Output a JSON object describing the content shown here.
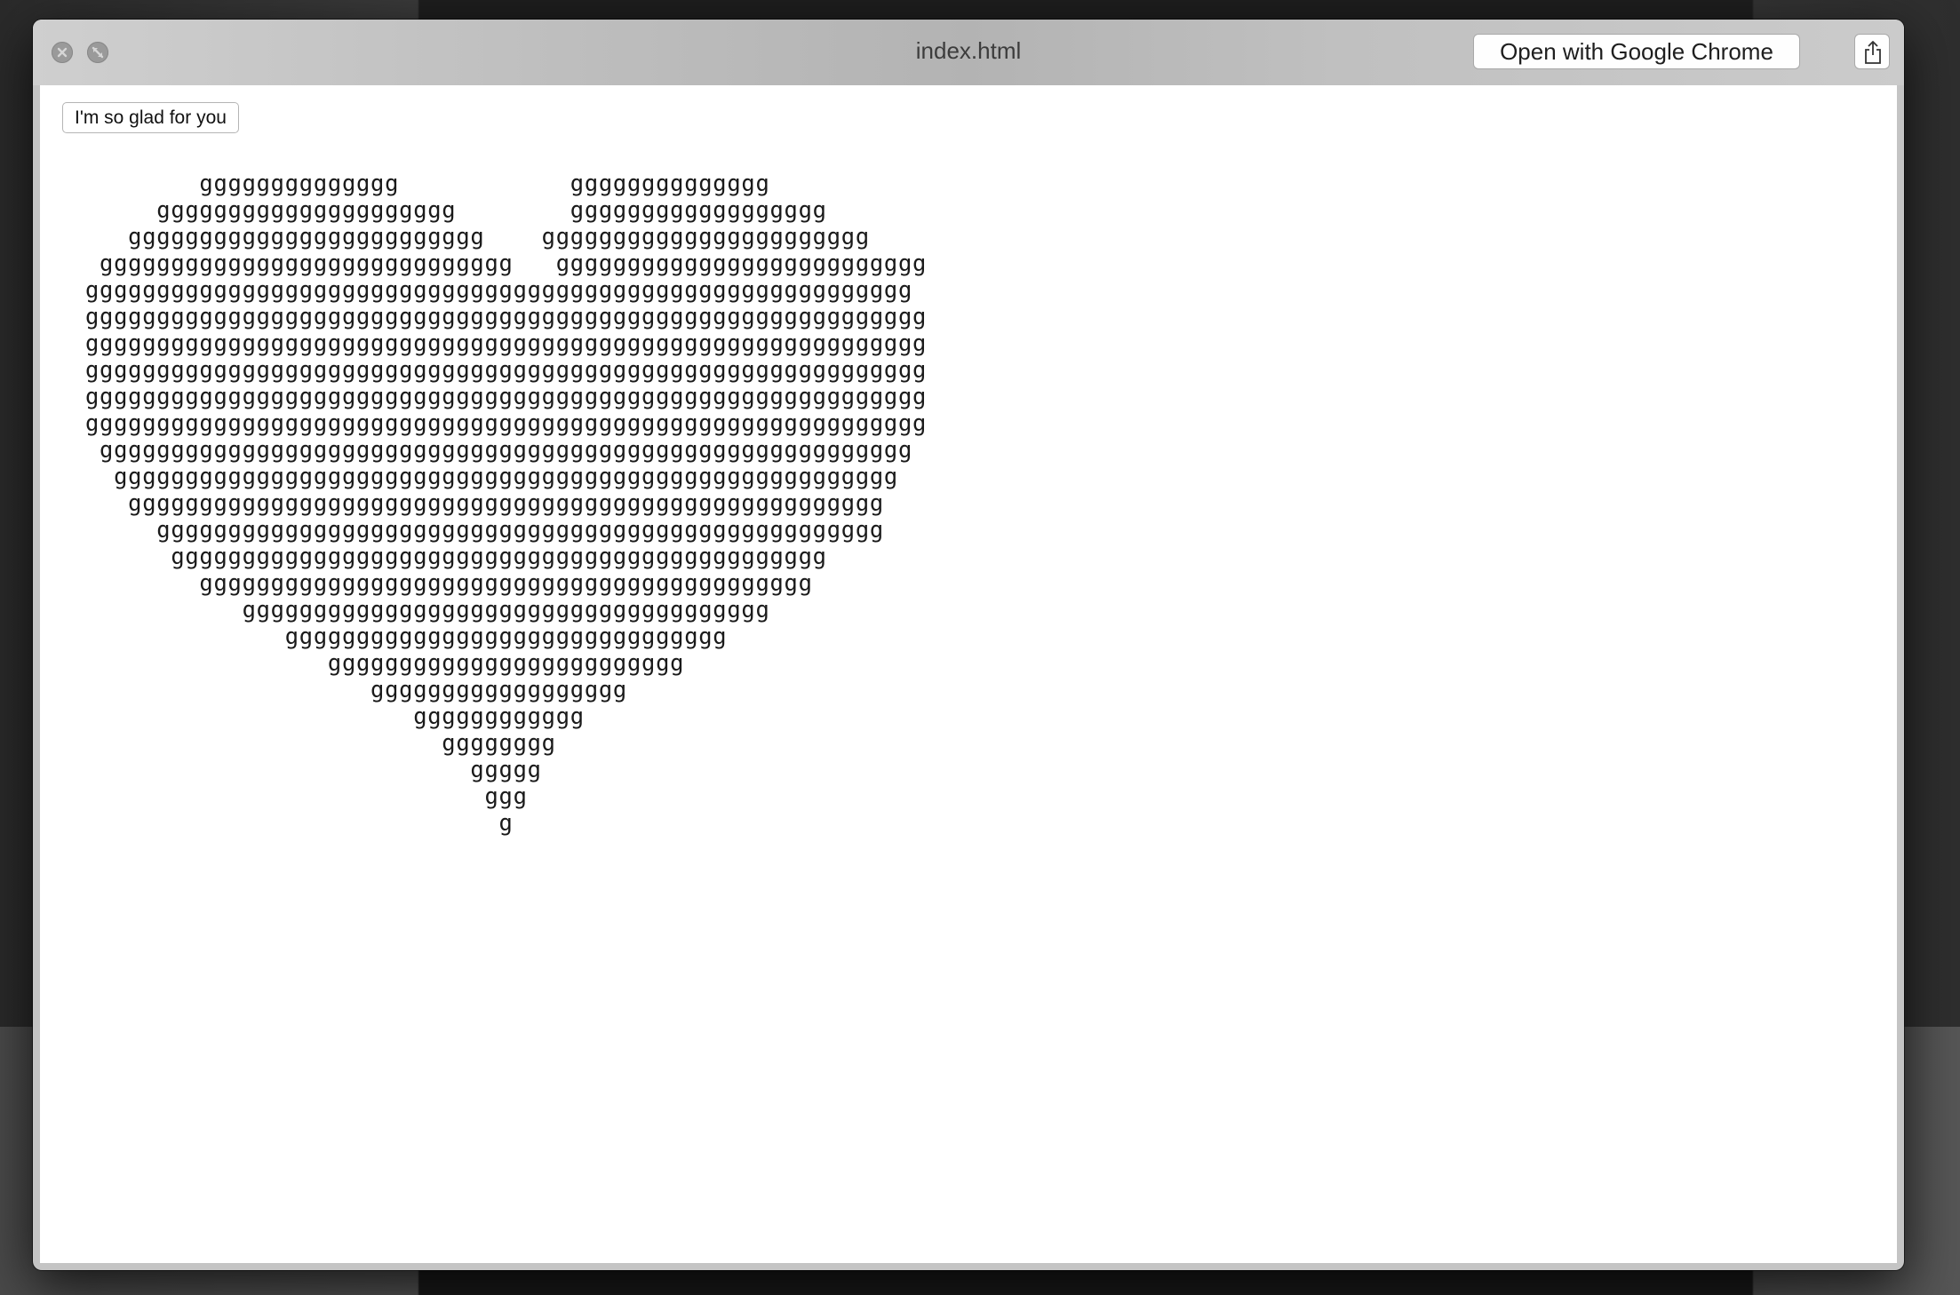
{
  "window": {
    "title": "index.html",
    "open_with_label": "Open with Google Chrome"
  },
  "icons": {
    "close": "close-icon",
    "minimize": "minimize-icon",
    "share": "share-icon"
  },
  "page": {
    "button_label": "I'm so glad for you",
    "heart_art": "        gggggggggggggg            gggggggggggggg\n     ggggggggggggggggggggg        gggggggggggggggggg\n   ggggggggggggggggggggggggg    ggggggggggggggggggggggg\n ggggggggggggggggggggggggggggg   gggggggggggggggggggggggggg\ngggggggggggggggggggggggggggggggggggggggggggggggggggggggggg\nggggggggggggggggggggggggggggggggggggggggggggggggggggggggggg\nggggggggggggggggggggggggggggggggggggggggggggggggggggggggggg\nggggggggggggggggggggggggggggggggggggggggggggggggggggggggggg\nggggggggggggggggggggggggggggggggggggggggggggggggggggggggggg\nggggggggggggggggggggggggggggggggggggggggggggggggggggggggggg\n ggggggggggggggggggggggggggggggggggggggggggggggggggggggggg\n  ggggggggggggggggggggggggggggggggggggggggggggggggggggggg\n   ggggggggggggggggggggggggggggggggggggggggggggggggggggg\n     ggggggggggggggggggggggggggggggggggggggggggggggggggg\n      gggggggggggggggggggggggggggggggggggggggggggggg\n        ggggggggggggggggggggggggggggggggggggggggggg\n           ggggggggggggggggggggggggggggggggggggg\n              ggggggggggggggggggggggggggggggg\n                 ggggggggggggggggggggggggg\n                    gggggggggggggggggg\n                       gggggggggggg\n                         gggggggg\n                           ggggg\n                            ggg\n                             g"
  }
}
